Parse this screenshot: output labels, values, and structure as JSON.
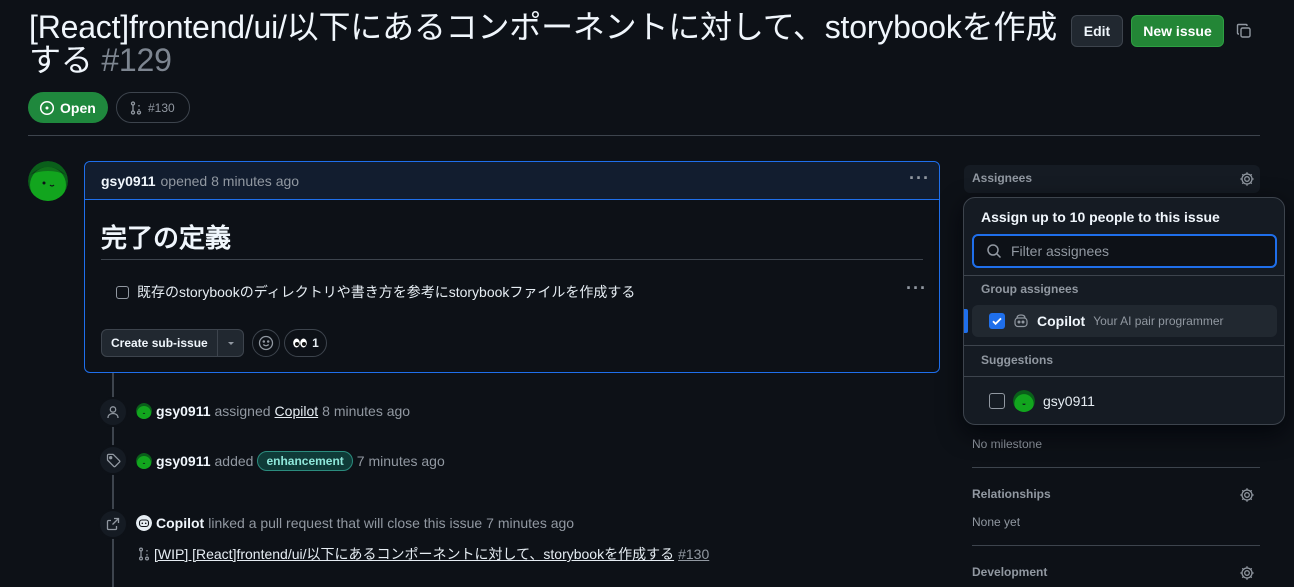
{
  "issue": {
    "title": "[React]frontend/ui/以下にあるコンポーネントに対して、storybookを作成する",
    "number": "#129",
    "state": "Open",
    "linked_pr": "#130"
  },
  "header_actions": {
    "edit": "Edit",
    "new_issue": "New issue"
  },
  "comment": {
    "author": "gsy0911",
    "meta": "opened 8 minutes ago",
    "heading": "完了の定義",
    "task": "既存のstorybookのディレクトリや書き方を参考にstorybookファイルを作成する",
    "create_sub_issue": "Create sub-issue",
    "reaction_count": "1"
  },
  "timeline": {
    "assigned": {
      "actor": "gsy0911",
      "verb": "assigned",
      "target": "Copilot",
      "time": "8 minutes ago"
    },
    "labeled": {
      "actor": "gsy0911",
      "verb": "added",
      "label": "enhancement",
      "time": "7 minutes ago"
    },
    "linked": {
      "actor": "Copilot",
      "text": "linked a pull request that will close this issue",
      "time": "7 minutes ago",
      "pr_title": "[WIP] [React]frontend/ui/以下にあるコンポーネントに対して、storybookを作成する",
      "pr_number": "#130"
    }
  },
  "sidebar": {
    "assignees_title": "Assignees",
    "milestone_value": "No milestone",
    "relationships_title": "Relationships",
    "relationships_value": "None yet",
    "development_title": "Development"
  },
  "assignee_popover": {
    "title": "Assign up to 10 people to this issue",
    "filter_placeholder": "Filter assignees",
    "group_label": "Group assignees",
    "group_item": {
      "name": "Copilot",
      "description": "Your AI pair programmer",
      "checked": true
    },
    "suggestions_label": "Suggestions",
    "suggestion_item": {
      "name": "gsy0911",
      "checked": false
    }
  },
  "colors": {
    "accent": "#1f6feb",
    "open": "#1f883d",
    "new_issue": "#238636",
    "label": "#2b8c7e"
  }
}
